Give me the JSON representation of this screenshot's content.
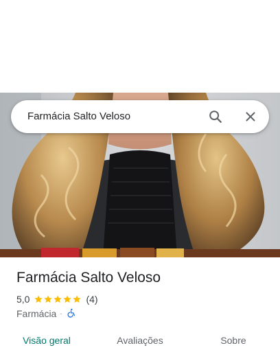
{
  "search": {
    "query": "Farmácia Salto Veloso"
  },
  "icons": {
    "search": "search-icon",
    "close": "close-icon",
    "star": "star-icon",
    "accessibility": "wheelchair-icon"
  },
  "place": {
    "name": "Farmácia Salto Veloso",
    "rating": "5,0",
    "stars_filled": 5,
    "stars_total": 5,
    "review_count": "(4)",
    "category": "Farmácia",
    "separator": "·"
  },
  "tabs": [
    {
      "label": "Visão geral",
      "active": true
    },
    {
      "label": "Avaliações",
      "active": false
    },
    {
      "label": "Sobre",
      "active": false
    }
  ],
  "colors": {
    "accent": "#00796b",
    "star": "#fbbc04",
    "accessibility_icon": "#1a73e8",
    "text_primary": "#202124",
    "text_secondary": "#5f6368"
  }
}
